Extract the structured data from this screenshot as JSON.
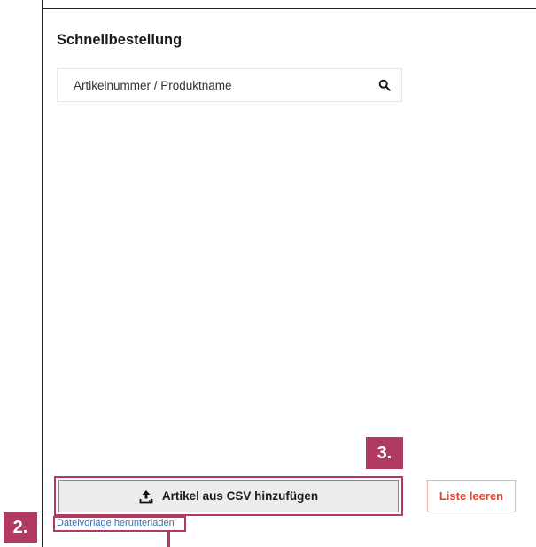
{
  "quick_order": {
    "title": "Schnellbestellung",
    "search": {
      "placeholder": "Artikelnummer / Produktname",
      "icon": "search-icon"
    }
  },
  "actions": {
    "csv_button_label": "Artikel aus CSV hinzufügen",
    "csv_button_icon": "upload-icon",
    "clear_list_label": "Liste leeren",
    "template_link_label": "Dateivorlage herunterladen"
  },
  "annotations": {
    "step_2": "2.",
    "step_3": "3.",
    "highlight_color": "#b03a62"
  },
  "colors": {
    "clear_button_text": "#e53e2b",
    "link": "#3a6fb0"
  }
}
